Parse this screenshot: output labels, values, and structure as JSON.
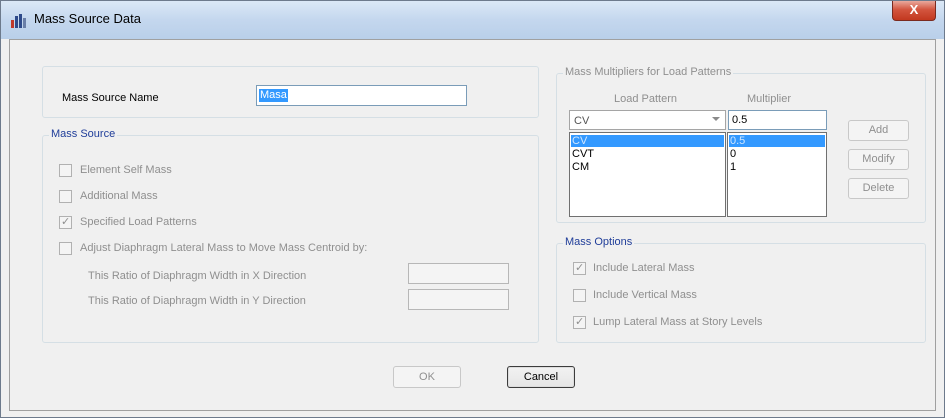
{
  "window": {
    "title": "Mass Source Data",
    "close_label": "X"
  },
  "name_row": {
    "label": "Mass Source Name",
    "value": "Masa"
  },
  "mass_source": {
    "legend": "Mass Source",
    "element_self_mass": "Element Self Mass",
    "additional_mass": "Additional Mass",
    "specified_load_patterns": "Specified Load Patterns",
    "adjust_diaphragm": "Adjust Diaphragm Lateral Mass to Move Mass Centroid by:",
    "ratio_x": "This Ratio of Diaphragm Width in X Direction",
    "ratio_y": "This Ratio of Diaphragm Width in Y Direction"
  },
  "multipliers": {
    "legend": "Mass Multipliers for Load Patterns",
    "col_load_pattern": "Load Pattern",
    "col_multiplier": "Multiplier",
    "selected_pattern": "CV",
    "multiplier_value": "0.5",
    "rows": [
      {
        "pattern": "CV",
        "multiplier": "0.5"
      },
      {
        "pattern": "CVT",
        "multiplier": "0"
      },
      {
        "pattern": "CM",
        "multiplier": "1"
      }
    ],
    "add_label": "Add",
    "modify_label": "Modify",
    "delete_label": "Delete"
  },
  "mass_options": {
    "legend": "Mass Options",
    "include_lateral": "Include Lateral Mass",
    "include_vertical": "Include Vertical Mass",
    "lump_lateral": "Lump Lateral Mass at Story Levels"
  },
  "footer": {
    "ok_label": "OK",
    "cancel_label": "Cancel"
  }
}
